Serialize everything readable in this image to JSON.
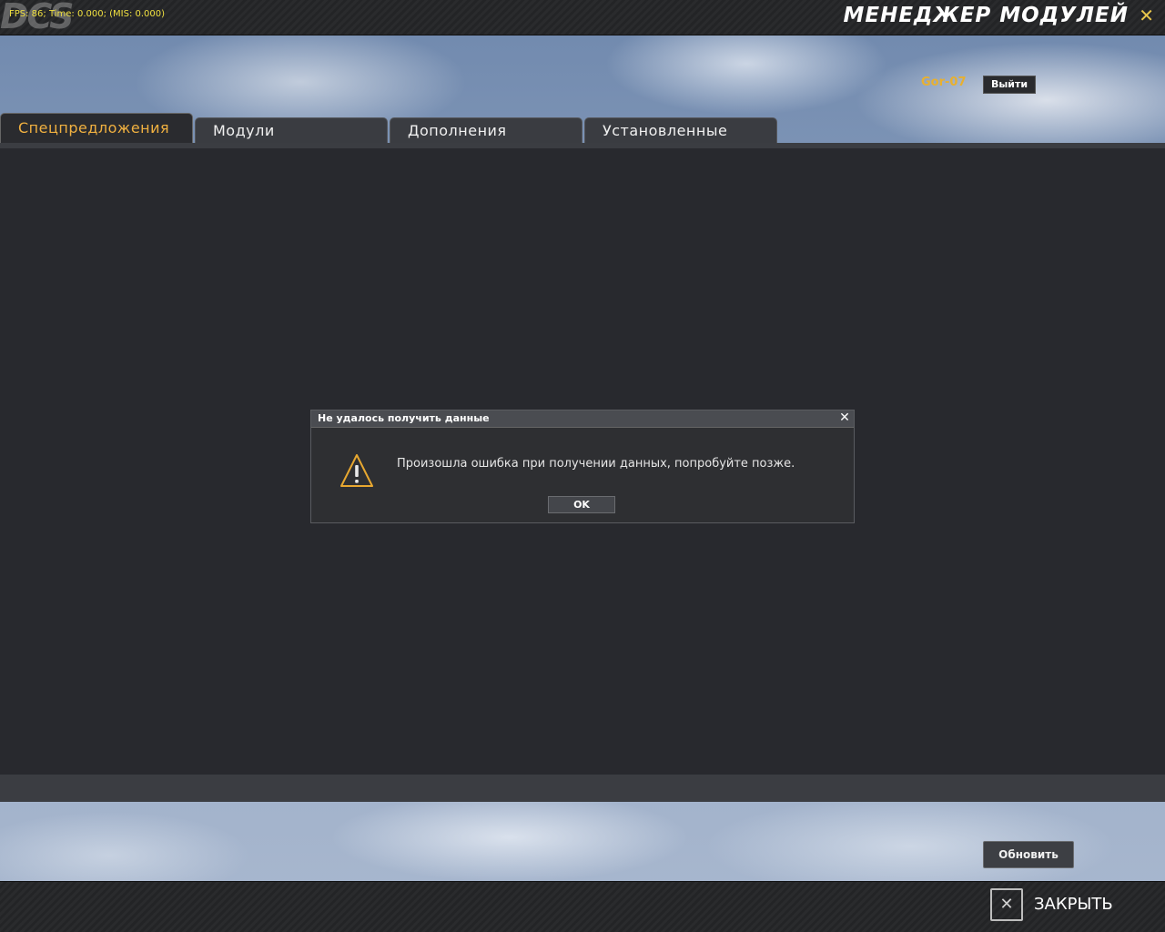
{
  "topbar": {
    "logo": "DCS",
    "fps_text": "FPS:   86; Time: 0.000; (MIS: 0.000)",
    "title": "МЕНЕДЖЕР МОДУЛЕЙ",
    "close_icon": "✕"
  },
  "user": {
    "name": "Gor-07",
    "logout_label": "Выйти"
  },
  "tabs": [
    {
      "label": "Спецпредложения",
      "active": true
    },
    {
      "label": "Модули",
      "active": false
    },
    {
      "label": "Дополнения",
      "active": false
    },
    {
      "label": "Установленные",
      "active": false
    }
  ],
  "dialog": {
    "title": "Не удалось получить данные",
    "close_icon": "✕",
    "icon": "warning-icon",
    "message": "Произошла ошибка при получении данных, попробуйте позже.",
    "ok_label": "OK"
  },
  "footer": {
    "refresh_label": "Обновить",
    "close_icon": "✕",
    "close_label": "ЗАКРЫТЬ"
  },
  "colors": {
    "accent": "#f0b040",
    "username": "#e8b030",
    "content_bg": "#28292e"
  }
}
